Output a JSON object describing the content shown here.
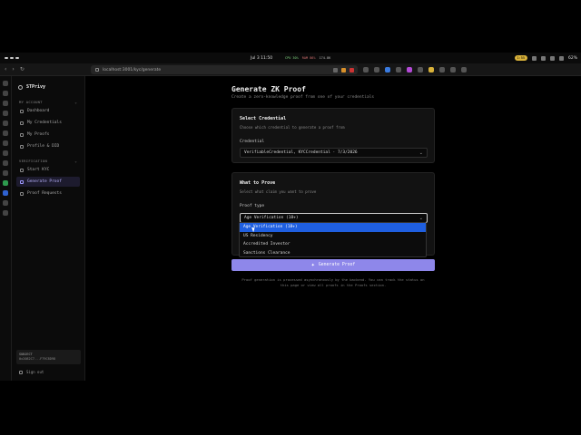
{
  "menubar": {
    "clock": "Jul 3  11:50",
    "stats": [
      "CPU 30%",
      "RAM 86%",
      "174.8K"
    ],
    "battery": "62%",
    "pill": "1:55"
  },
  "browser": {
    "url": "localhost:3001/kyc/generate",
    "nav": [
      "‹",
      "›",
      "↻"
    ]
  },
  "sidebar": {
    "brand": "STPrivy",
    "sections": [
      {
        "title": "MY ACCOUNT",
        "items": [
          {
            "label": "Dashboard"
          },
          {
            "label": "My Credentials"
          },
          {
            "label": "My Proofs"
          },
          {
            "label": "Profile & DID"
          }
        ]
      },
      {
        "title": "VERIFICATION",
        "items": [
          {
            "label": "Start KYC"
          },
          {
            "label": "Generate Proof"
          },
          {
            "label": "Proof Requests"
          }
        ]
      }
    ],
    "subject_label": "SUBJECT",
    "subject_value": "0x2082C7...F79C8D98",
    "signout": "Sign out"
  },
  "page": {
    "title": "Generate ZK Proof",
    "subtitle": "Create a zero-knowledge proof from one of your credentials",
    "select_credential": {
      "heading": "Select Credential",
      "desc": "Choose which credential to generate a proof from",
      "label": "Credential",
      "value": "VerifiableCredential, KYCCredential · 7/3/2026"
    },
    "what_to_prove": {
      "heading": "What to Prove",
      "desc": "Select what claim you want to prove",
      "label": "Proof type",
      "value": "Age Verification (18+)",
      "options": [
        "Age Verification (18+)",
        "US Residency",
        "Accredited Investor",
        "Sanctions Clearance"
      ]
    },
    "generate_button": "Generate Proof",
    "note_line1": "Proof generation is processed asynchronously by the backend. You can track the status on",
    "note_line2": "this page or view all proofs in the Proofs section."
  }
}
